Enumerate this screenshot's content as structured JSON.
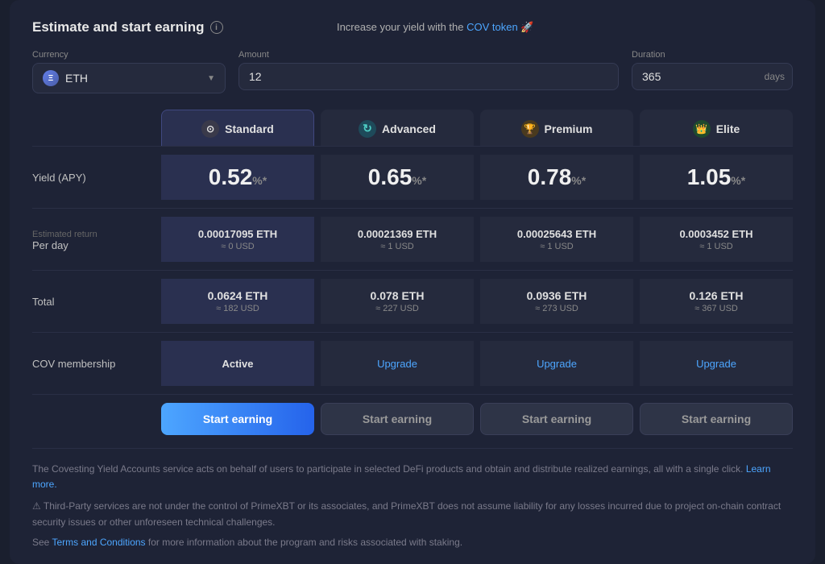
{
  "page": {
    "title": "Estimate and start earning",
    "topNotice": "Increase your yield with the",
    "covLink": "COV token",
    "emoji": "🚀"
  },
  "controls": {
    "currencyLabel": "Currency",
    "currencyValue": "ETH",
    "amountLabel": "Amount",
    "amountValue": "12",
    "amountPlaceholder": "Amount",
    "durationLabel": "Duration",
    "durationValue": "365",
    "durationUnit": "days"
  },
  "plans": [
    {
      "id": "standard",
      "name": "Standard",
      "icon": "⊙",
      "iconClass": "icon-standard",
      "selected": true,
      "apy": "0.52%",
      "perDayMain": "0.00017095 ETH",
      "perDaySub": "≈ 0 USD",
      "totalMain": "0.0624 ETH",
      "totalSub": "≈ 182 USD",
      "membership": "Active",
      "membershipType": "active",
      "btnLabel": "Start earning",
      "btnType": "primary"
    },
    {
      "id": "advanced",
      "name": "Advanced",
      "icon": "⟳",
      "iconClass": "icon-advanced",
      "selected": false,
      "apy": "0.65%",
      "perDayMain": "0.00021369 ETH",
      "perDaySub": "≈ 1 USD",
      "totalMain": "0.078 ETH",
      "totalSub": "≈ 227 USD",
      "membership": "Upgrade",
      "membershipType": "upgrade",
      "btnLabel": "Start earning",
      "btnType": "secondary"
    },
    {
      "id": "premium",
      "name": "Premium",
      "icon": "🏆",
      "iconClass": "icon-premium",
      "selected": false,
      "apy": "0.78%",
      "perDayMain": "0.00025643 ETH",
      "perDaySub": "≈ 1 USD",
      "totalMain": "0.0936 ETH",
      "totalSub": "≈ 273 USD",
      "membership": "Upgrade",
      "membershipType": "upgrade",
      "btnLabel": "Start earning",
      "btnType": "secondary"
    },
    {
      "id": "elite",
      "name": "Elite",
      "icon": "👑",
      "iconClass": "icon-elite",
      "selected": false,
      "apy": "1.05%",
      "perDayMain": "0.0003452 ETH",
      "perDaySub": "≈ 1 USD",
      "totalMain": "0.126 ETH",
      "totalSub": "≈ 367 USD",
      "membership": "Upgrade",
      "membershipType": "upgrade",
      "btnLabel": "Start earning",
      "btnType": "secondary"
    }
  ],
  "rows": {
    "yieldLabel": "Yield (APY)",
    "estimatedReturnLabel": "Estimated return",
    "perDayLabel": "Per day",
    "totalLabel": "Total",
    "covMembershipLabel": "COV membership"
  },
  "footer": {
    "mainText": "The Covesting Yield Accounts service acts on behalf of users to participate in selected DeFi products and obtain and distribute realized earnings, all with a single click.",
    "learnMore": "Learn more.",
    "warningText": "⚠ Third-Party services are not under the control of PrimeXBT or its associates, and PrimeXBT does not assume liability for any losses incurred due to project on-chain contract security issues or other unforeseen technical challenges.",
    "termsPrefix": "See",
    "termsLink": "Terms and Conditions",
    "termsSuffix": "for more information about the program and risks associated with staking."
  }
}
